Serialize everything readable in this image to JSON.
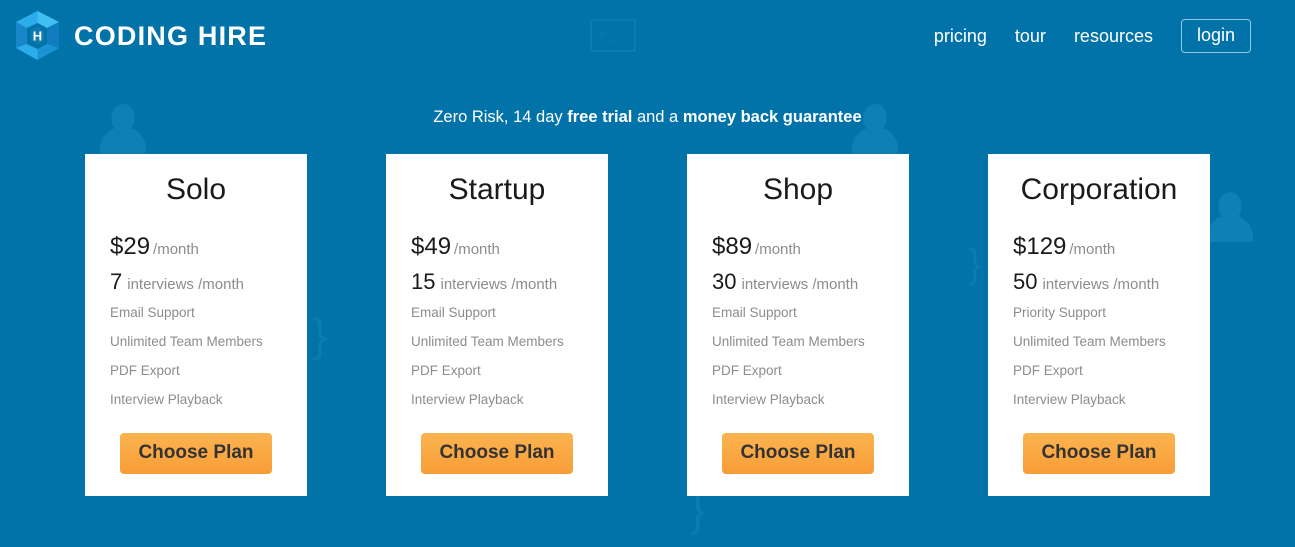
{
  "brand": {
    "name": "CODING HIRE",
    "logo_icon": "hexagon-cube-logo",
    "logo_letter": "H",
    "logo_color": "#29abe2"
  },
  "colors": {
    "page_background": "#0273a9",
    "card_background": "#ffffff",
    "accent_button": "#fbb450",
    "muted_text": "#8c8c8c",
    "dark_text": "#1a1a1a"
  },
  "nav": {
    "links": [
      {
        "label": "pricing"
      },
      {
        "label": "tour"
      },
      {
        "label": "resources"
      }
    ],
    "login_label": "login"
  },
  "tagline": {
    "part1": "Zero Risk, 14 day ",
    "bold1": "free trial",
    "part2": " and a ",
    "bold2": "money back guarantee"
  },
  "plans": [
    {
      "title": "Solo",
      "price": "$29",
      "price_unit": "/month",
      "interviews": "7",
      "interviews_label": "interviews /month",
      "features": [
        "Email Support",
        "Unlimited Team Members",
        "PDF Export",
        "Interview Playback"
      ],
      "cta": "Choose Plan"
    },
    {
      "title": "Startup",
      "price": "$49",
      "price_unit": "/month",
      "interviews": "15",
      "interviews_label": "interviews /month",
      "features": [
        "Email Support",
        "Unlimited Team Members",
        "PDF Export",
        "Interview Playback"
      ],
      "cta": "Choose Plan"
    },
    {
      "title": "Shop",
      "price": "$89",
      "price_unit": "/month",
      "interviews": "30",
      "interviews_label": "interviews /month",
      "features": [
        "Email Support",
        "Unlimited Team Members",
        "PDF Export",
        "Interview Playback"
      ],
      "cta": "Choose Plan"
    },
    {
      "title": "Corporation",
      "price": "$129",
      "price_unit": "/month",
      "interviews": "50",
      "interviews_label": "interviews /month",
      "features": [
        "Priority Support",
        "Unlimited Team Members",
        "PDF Export",
        "Interview Playback"
      ],
      "cta": "Choose Plan"
    }
  ],
  "decorations": {
    "console_prompt": ">_",
    "brace": "}",
    "person_icon": "person-silhouette-icon"
  }
}
